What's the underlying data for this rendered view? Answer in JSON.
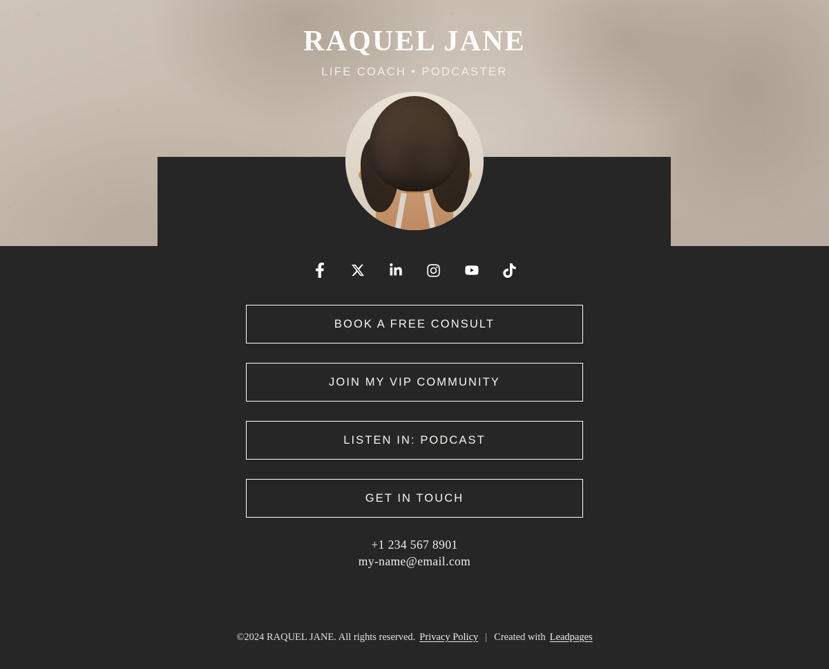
{
  "brand": {
    "name": "RAQUEL JANE",
    "tagline": "LIFE COACH • PODCASTER",
    "portrait_alt": "portrait-photo"
  },
  "socials": [
    {
      "name": "facebook",
      "label": "Facebook"
    },
    {
      "name": "x-twitter",
      "label": "X"
    },
    {
      "name": "linkedin",
      "label": "LinkedIn"
    },
    {
      "name": "instagram",
      "label": "Instagram"
    },
    {
      "name": "youtube",
      "label": "YouTube"
    },
    {
      "name": "tiktok",
      "label": "TikTok"
    }
  ],
  "cta_buttons": [
    {
      "label": "BOOK A FREE CONSULT"
    },
    {
      "label": "JOIN MY VIP COMMUNITY"
    },
    {
      "label": "LISTEN IN: PODCAST"
    },
    {
      "label": "GET IN TOUCH"
    }
  ],
  "contact": {
    "phone": "+1 234 567 8901",
    "email": "my-name@email.com"
  },
  "footer": {
    "copyright": "©2024 RAQUEL JANE. All rights reserved.",
    "privacy_link": "Privacy Policy",
    "separator": "|",
    "created_with": "Created with",
    "builder_link": "Leadpages"
  },
  "colors": {
    "dark_panel": "#262626",
    "hero_bg": "#c5b9ac",
    "text_light": "#f7f4ef",
    "border": "#ffffff"
  }
}
